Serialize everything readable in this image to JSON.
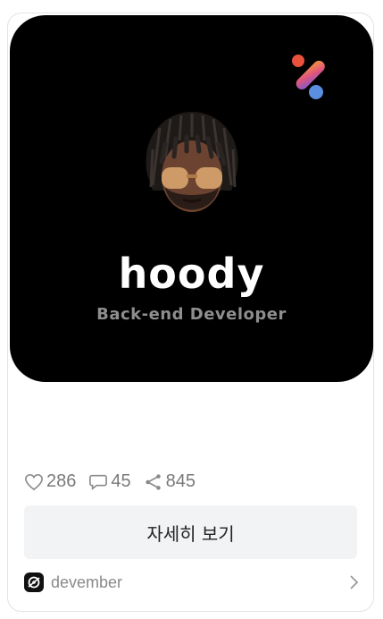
{
  "card": {
    "profile_name": "hoody",
    "profile_role": "Back-end Developer",
    "stats": {
      "likes": "286",
      "comments": "45",
      "shares": "845"
    },
    "detail_button_label": "자세히 보기",
    "source_name": "devember"
  },
  "icons": {
    "brand": "brand-logo-icon",
    "avatar": "memoji-avatar",
    "like": "heart-icon",
    "comment": "comment-icon",
    "share": "share-icon",
    "source": "devember-logo-icon",
    "chevron": "chevron-right-icon"
  },
  "colors": {
    "hero_background": "#000000",
    "button_background": "#f2f3f5",
    "muted_text": "#7a7a7a"
  }
}
